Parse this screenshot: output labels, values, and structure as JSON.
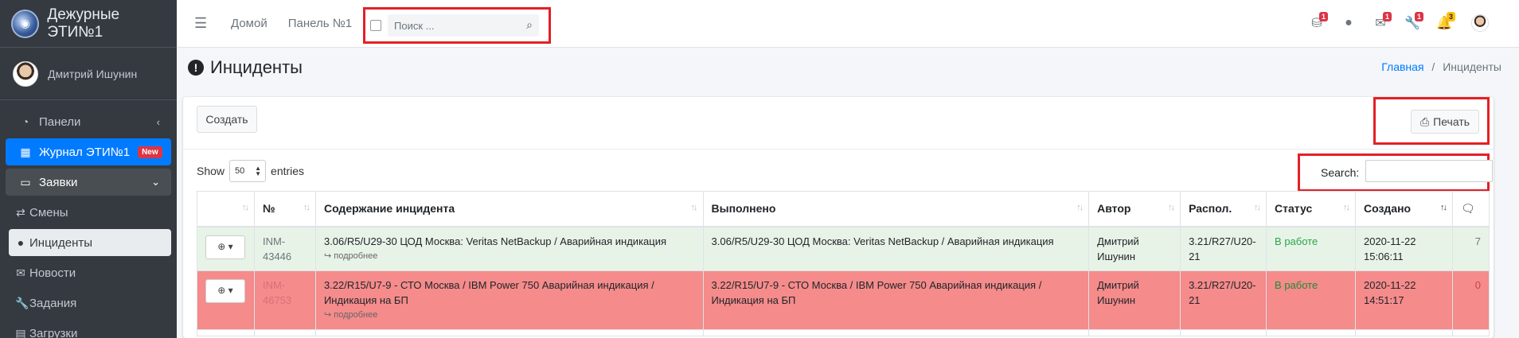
{
  "brand": {
    "title": "Дежурные ЭТИ№1"
  },
  "user": {
    "name": "Дмитрий Ишунин"
  },
  "sidebar": {
    "items": [
      {
        "label": "Панели",
        "icon": "tachometer-icon"
      },
      {
        "label": "Журнал ЭТИ№1",
        "icon": "grid-icon",
        "badge": "New"
      },
      {
        "label": "Заявки",
        "icon": "inbox-icon"
      },
      {
        "label": "Смены",
        "icon": "exchange-icon"
      },
      {
        "label": "Инциденты",
        "icon": "exclamation-circle-icon"
      },
      {
        "label": "Новости",
        "icon": "envelope-icon"
      },
      {
        "label": "Задания",
        "icon": "wrench-icon"
      },
      {
        "label": "Загрузки",
        "icon": "file-icon"
      }
    ]
  },
  "topbar": {
    "links": [
      "Домой",
      "Панель №1"
    ],
    "search_placeholder": "Поиск ...",
    "counters": {
      "devices": "1",
      "messages": "1",
      "tools": "1",
      "notifications": "3"
    }
  },
  "page": {
    "title": "Инциденты",
    "breadcrumb": {
      "home": "Главная",
      "current": "Инциденты"
    }
  },
  "toolbar": {
    "create_label": "Создать",
    "print_label": "Печать"
  },
  "table_controls": {
    "show": "Show",
    "entries": "entries",
    "page_size": "50",
    "search_label": "Search:"
  },
  "table": {
    "columns": [
      "№",
      "Содержание инцидента",
      "Выполнено",
      "Автор",
      "Распол.",
      "Статус",
      "Создано"
    ],
    "more_label": "подробнее",
    "rows": [
      {
        "number": "INM-43446",
        "content": "3.06/R5/U29-30 ЦОД Москва: Veritas NetBackup / Аварийная индикация",
        "done": "3.06/R5/U29-30 ЦОД Москва: Veritas NetBackup / Аварийная индикация",
        "author": "Дмитрий Ишунин",
        "location": "3.21/R27/U20-21",
        "status": "В работе",
        "created": "2020-11-22 15:06:11",
        "comments": "7"
      },
      {
        "number": "INM-46753",
        "content": "3.22/R15/U7-9 - СТО Москва / IBM Power 750 Аварийная индикация / Индикация на БП",
        "done": "3.22/R15/U7-9 - СТО Москва / IBM Power 750 Аварийная индикация / Индикация на БП",
        "author": "Дмитрий Ишунин",
        "location": "3.21/R27/U20-21",
        "status": "В работе",
        "created": "2020-11-22 14:51:17",
        "comments": "0"
      }
    ]
  }
}
